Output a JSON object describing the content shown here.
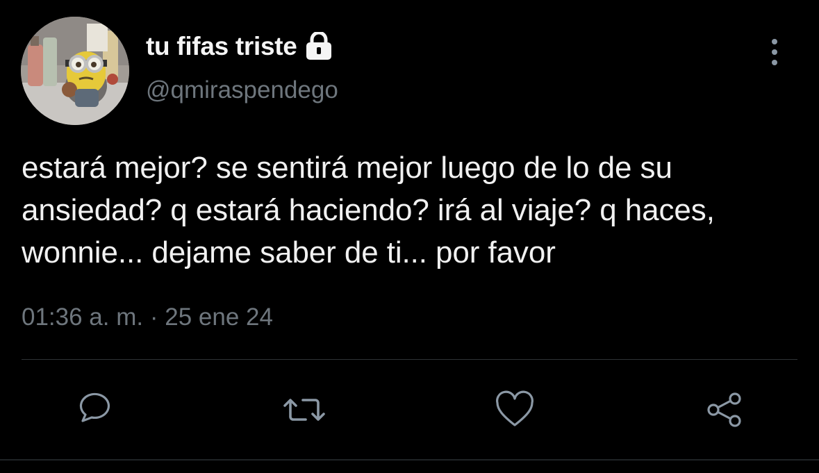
{
  "user": {
    "display_name": "tu fifas triste",
    "handle": "@qmiraspendego",
    "protected": true,
    "avatar": "minion-figure-avatar"
  },
  "tweet": {
    "text": "estará mejor? se sentirá mejor luego de lo de su ansiedad? q estará haciendo? irá al viaje? q haces, wonnie... dejame saber de ti... por favor",
    "time": "01:36 a. m.",
    "separator": "·",
    "date": "25 ene 24"
  },
  "actions": [
    {
      "name": "reply",
      "icon": "reply-icon"
    },
    {
      "name": "retweet",
      "icon": "retweet-icon"
    },
    {
      "name": "like",
      "icon": "heart-icon"
    },
    {
      "name": "share",
      "icon": "share-icon"
    }
  ],
  "colors": {
    "background": "#000000",
    "text_primary": "#f1f1f1",
    "text_secondary": "#6e767d",
    "icon": "#8b98a5",
    "divider": "#2f3336"
  }
}
